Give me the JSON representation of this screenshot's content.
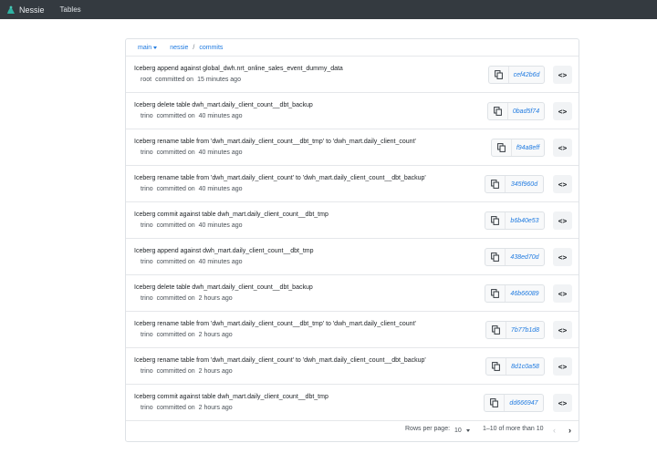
{
  "navbar": {
    "brand": "Nessie",
    "nav_tables": "Tables"
  },
  "breadcrumb": {
    "branch": "main",
    "repo": "nessie",
    "separator": "/",
    "section": "commits"
  },
  "commits": [
    {
      "message": "Iceberg append against global_dwh.nrt_online_sales_event_dummy_data",
      "author": "root",
      "action": "committed on",
      "time": "15 minutes ago",
      "hash": "cef42b6d"
    },
    {
      "message": "Iceberg delete table dwh_mart.daily_client_count__dbt_backup",
      "author": "trino",
      "action": "committed on",
      "time": "40 minutes ago",
      "hash": "0bad5f74"
    },
    {
      "message": "Iceberg rename table from 'dwh_mart.daily_client_count__dbt_tmp' to 'dwh_mart.daily_client_count'",
      "author": "trino",
      "action": "committed on",
      "time": "40 minutes ago",
      "hash": "f94a8eff"
    },
    {
      "message": "Iceberg rename table from 'dwh_mart.daily_client_count' to 'dwh_mart.daily_client_count__dbt_backup'",
      "author": "trino",
      "action": "committed on",
      "time": "40 minutes ago",
      "hash": "345f960d"
    },
    {
      "message": "Iceberg commit against table dwh_mart.daily_client_count__dbt_tmp",
      "author": "trino",
      "action": "committed on",
      "time": "40 minutes ago",
      "hash": "b6b40e53"
    },
    {
      "message": "Iceberg append against dwh_mart.daily_client_count__dbt_tmp",
      "author": "trino",
      "action": "committed on",
      "time": "40 minutes ago",
      "hash": "438ed70d"
    },
    {
      "message": "Iceberg delete table dwh_mart.daily_client_count__dbt_backup",
      "author": "trino",
      "action": "committed on",
      "time": "2 hours ago",
      "hash": "46b66089"
    },
    {
      "message": "Iceberg rename table from 'dwh_mart.daily_client_count__dbt_tmp' to 'dwh_mart.daily_client_count'",
      "author": "trino",
      "action": "committed on",
      "time": "2 hours ago",
      "hash": "7b77b1d8"
    },
    {
      "message": "Iceberg rename table from 'dwh_mart.daily_client_count' to 'dwh_mart.daily_client_count__dbt_backup'",
      "author": "trino",
      "action": "committed on",
      "time": "2 hours ago",
      "hash": "8d1c0a58"
    },
    {
      "message": "Iceberg commit against table dwh_mart.daily_client_count__dbt_tmp",
      "author": "trino",
      "action": "committed on",
      "time": "2 hours ago",
      "hash": "dd666947"
    }
  ],
  "code_button_label": "<>",
  "pagination": {
    "rows_per_page_label": "Rows per page:",
    "rows_per_page_value": "10",
    "range": "1–10 of more than 10",
    "prev": "‹",
    "next": "›"
  },
  "icons": {
    "brand": "nessie-logo-icon",
    "copy": "copy-icon",
    "code": "code-icon"
  },
  "colors": {
    "navbar": "#343a40",
    "link": "#1f7ae0"
  }
}
